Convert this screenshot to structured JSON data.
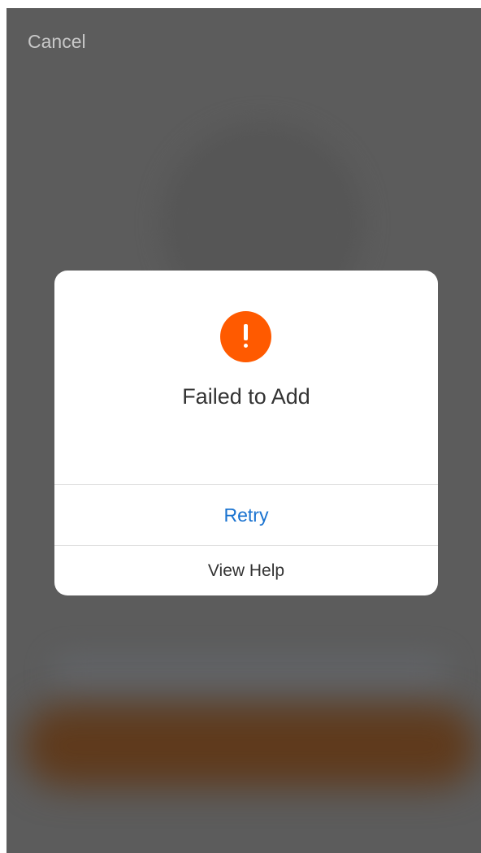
{
  "header": {
    "cancel_label": "Cancel"
  },
  "dialog": {
    "icon": "exclamation-icon",
    "icon_color": "#ff5a00",
    "title": "Failed to Add",
    "primary_action": "Retry",
    "secondary_action": "View Help",
    "primary_color": "#1a73d0"
  }
}
